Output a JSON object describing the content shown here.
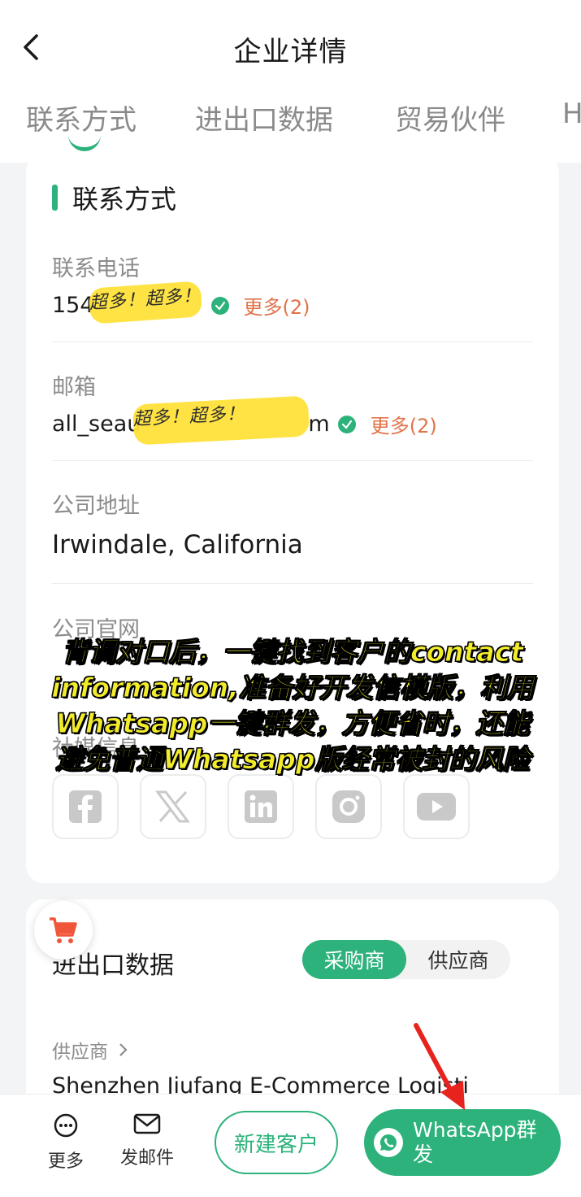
{
  "header": {
    "title": "企业详情"
  },
  "tabs": [
    "联系方式",
    "进出口数据",
    "贸易伙伴",
    "H"
  ],
  "contact_card": {
    "section_title": "联系方式",
    "phone": {
      "label": "联系电话",
      "value_visible_prefix": "154",
      "more": "更多(2)"
    },
    "email": {
      "label": "邮箱",
      "value_visible_prefix": "all_seau",
      "value_visible_suffix": "m",
      "more": "更多(2)"
    },
    "address": {
      "label": "公司地址",
      "value": "Irwindale, California"
    },
    "website": {
      "label": "公司官网"
    },
    "social_label": "社媒信息",
    "social_icons": [
      "facebook-icon",
      "x-twitter-icon",
      "linkedin-icon",
      "instagram-icon",
      "youtube-icon"
    ]
  },
  "overlay_caption": [
    "背调对口后，一键找到客户的contact",
    "information,准备好开发信模版，利用",
    "Whatsapp一键群发，方便省时，还能",
    "避免普通Whatsapp版经常被封的风险"
  ],
  "scribble_text": "超多！超多！",
  "trade_card": {
    "title": "进出口数据",
    "segments": [
      "采购商",
      "供应商"
    ],
    "supplier_label": "供应商",
    "supplier_name": "Shenzhen Jiufang E-Commerce Logisti"
  },
  "bottom_bar": {
    "more": "更多",
    "email": "发邮件",
    "new_customer": "新建客户",
    "whatsapp": "WhatsApp群发"
  },
  "colors": {
    "accent": "#2cb27a",
    "more_link": "#e0734a",
    "caption": "#f2ec2a",
    "arrow": "#e8221c"
  }
}
